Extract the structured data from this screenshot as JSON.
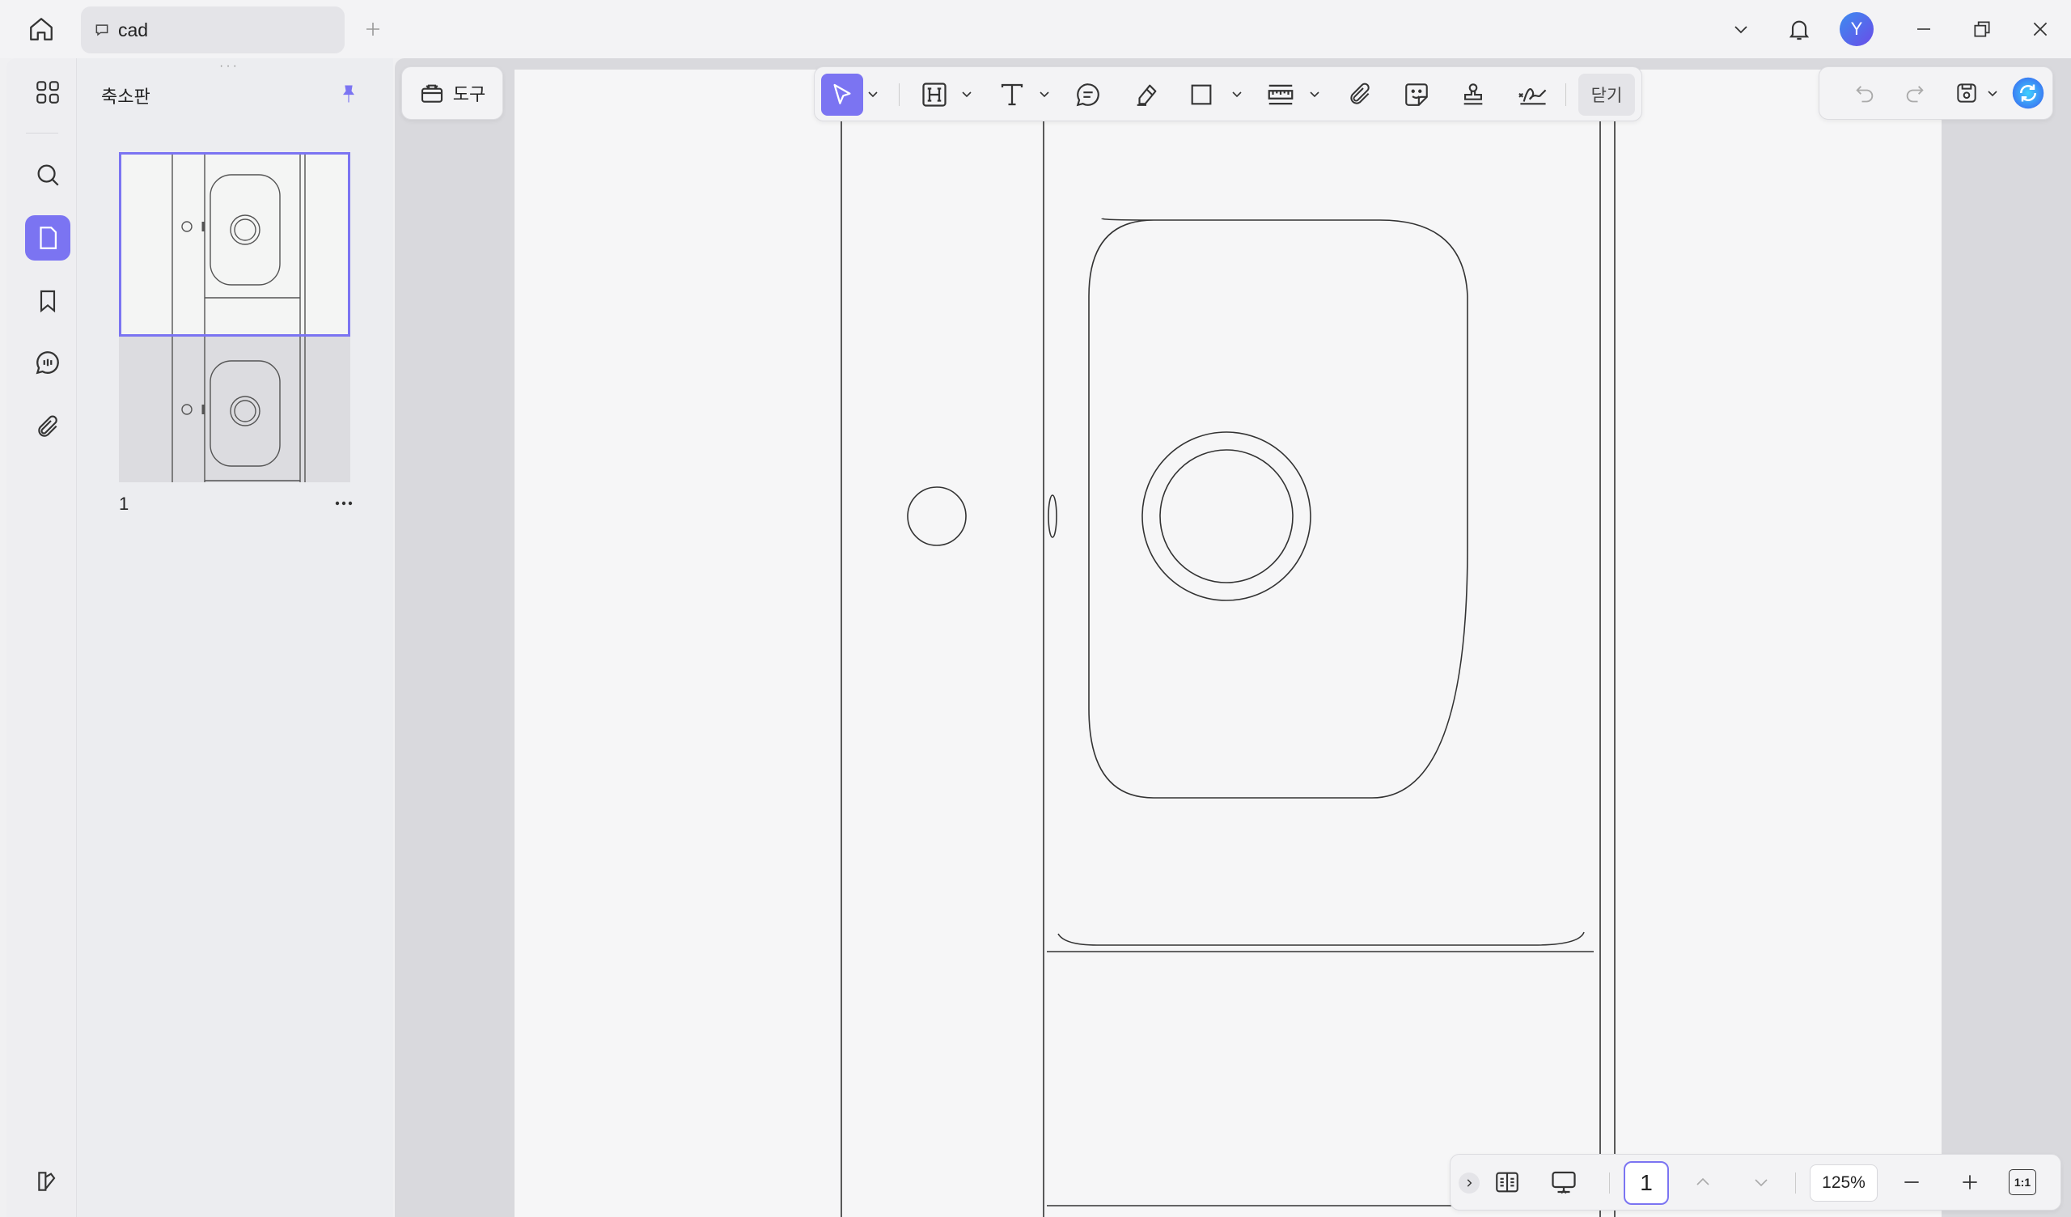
{
  "titlebar": {
    "tab_label": "cad",
    "tab_icon": "comment-icon",
    "new_tab_icon": "plus-icon",
    "avatar_letter": "Y",
    "avatar_color": "#5b57e8"
  },
  "rail": {
    "items": [
      {
        "name": "apps",
        "icon": "apps-grid-icon"
      },
      {
        "name": "search",
        "icon": "search-icon"
      },
      {
        "name": "pages",
        "icon": "page-icon",
        "active": true
      },
      {
        "name": "bookmark",
        "icon": "bookmark-icon"
      },
      {
        "name": "comments",
        "icon": "comment-icon"
      },
      {
        "name": "attachment",
        "icon": "paperclip-icon"
      }
    ],
    "bottom_icon": "theme-icon"
  },
  "panel": {
    "title": "축소판",
    "pin_icon": "pin-icon",
    "thumbnails": [
      {
        "page_label": "1",
        "selected": true
      }
    ]
  },
  "toolbar": {
    "tools_label": "도구",
    "close_label": "닫기",
    "tools": [
      {
        "name": "select",
        "icon": "cursor-icon",
        "active": true,
        "dropdown": true
      },
      {
        "name": "highlight",
        "icon": "highlight-h-icon",
        "dropdown": true
      },
      {
        "name": "text",
        "icon": "text-icon",
        "dropdown": true
      },
      {
        "name": "comment",
        "icon": "comment-icon"
      },
      {
        "name": "pencil",
        "icon": "pencil-icon"
      },
      {
        "name": "shape",
        "icon": "rectangle-icon",
        "dropdown": true
      },
      {
        "name": "measure",
        "icon": "ruler-icon",
        "dropdown": true
      },
      {
        "name": "attach",
        "icon": "paperclip-icon"
      },
      {
        "name": "sticker",
        "icon": "sticker-icon"
      },
      {
        "name": "stamp",
        "icon": "stamp-icon"
      },
      {
        "name": "signature",
        "icon": "signature-icon"
      }
    ]
  },
  "bottombar": {
    "page_number": "1",
    "zoom": "125%",
    "fit_label": "1:1"
  },
  "colors": {
    "accent": "#7b74f2",
    "background": "#f0f0f2"
  }
}
